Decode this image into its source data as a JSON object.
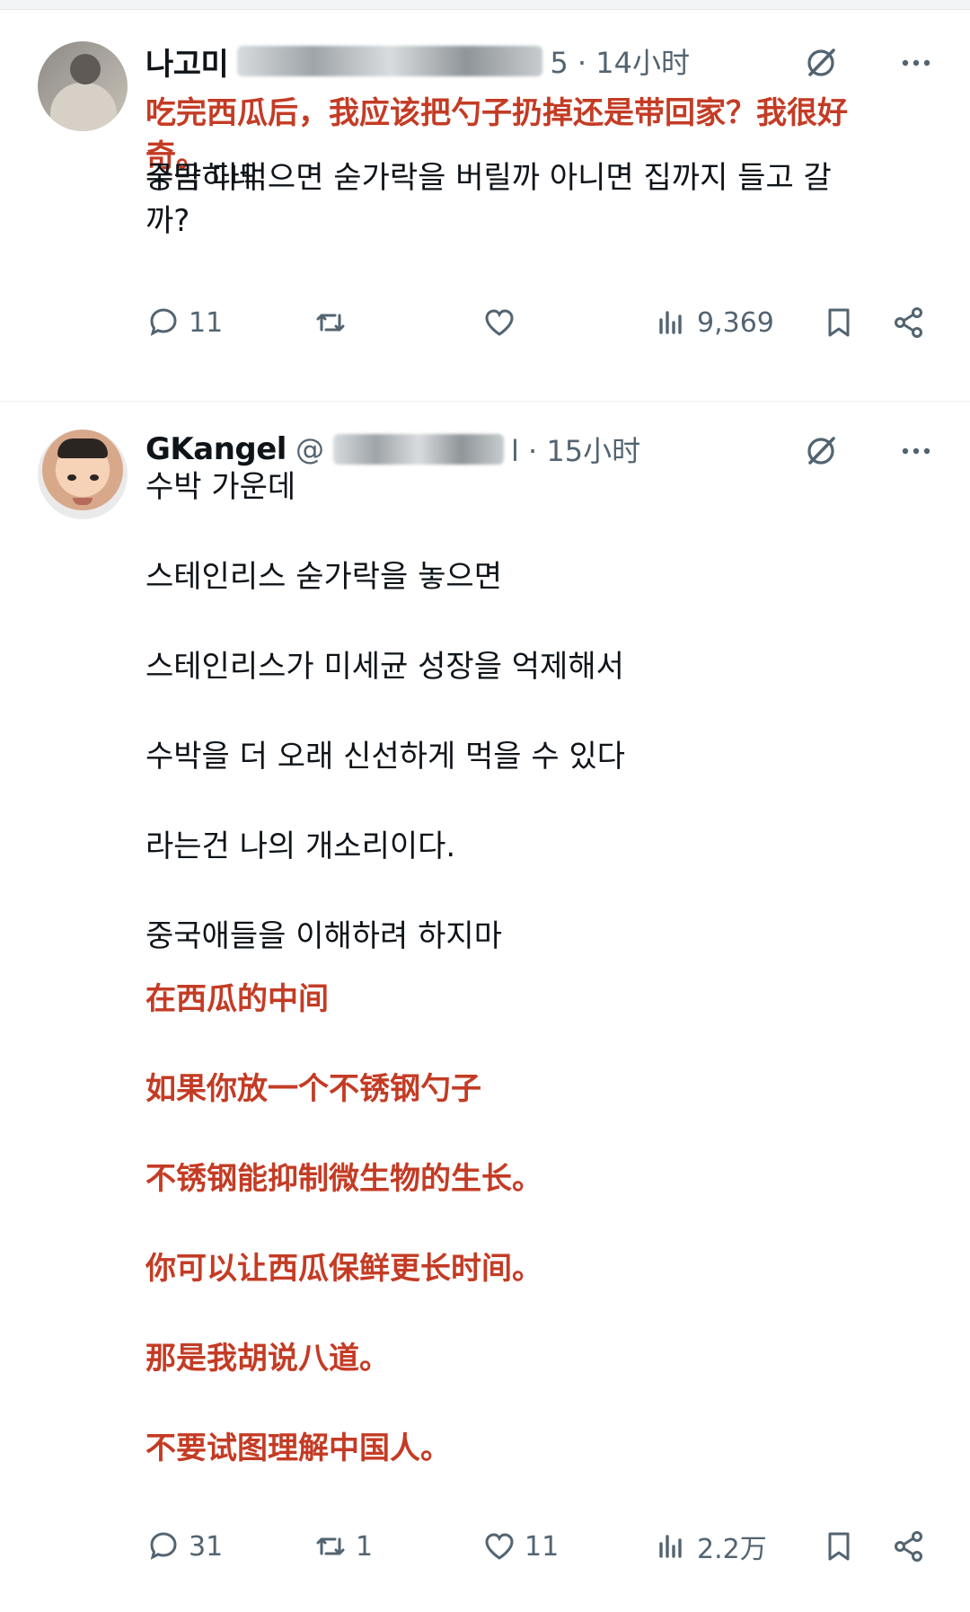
{
  "tweets": [
    {
      "name": "나고미",
      "meta": "5 · 14小时",
      "lines_ko": [
        "수박 다먹으면 숟가락을 버릴까 아니면 집까지 들고 갈까?",
        "궁금하네"
      ],
      "lines_zh": [
        "吃完西瓜后，我应该把勺子扔掉还是带回家？我很好",
        "奇。"
      ],
      "replies": "11",
      "retweets": "",
      "likes": "",
      "views": "9,369"
    },
    {
      "name": "GKangel",
      "at": "@",
      "meta": "l · 15小时",
      "lines_ko": [
        "수박 가운데",
        "스테인리스 숟가락을 놓으면",
        "스테인리스가 미세균 성장을 억제해서",
        "수박을 더 오래 신선하게 먹을 수 있다",
        "라는건 나의 개소리이다.",
        "중국애들을 이해하려 하지마"
      ],
      "lines_zh": [
        "在西瓜的中间",
        "如果你放一个不锈钢勺子",
        "不锈钢能抑制微生物的生长。",
        "你可以让西瓜保鲜更长时间。",
        "那是我胡说八道。",
        "不要试图理解中国人。"
      ],
      "replies": "31",
      "retweets": "1",
      "likes": "11",
      "views": "2.2万"
    }
  ],
  "colors": {
    "text": "#0f1419",
    "muted": "#536471",
    "translation": "#c43b24"
  },
  "icons": [
    "reply-icon",
    "retweet-icon",
    "like-icon",
    "views-icon",
    "bookmark-icon",
    "share-icon",
    "grok-icon",
    "more-icon"
  ]
}
